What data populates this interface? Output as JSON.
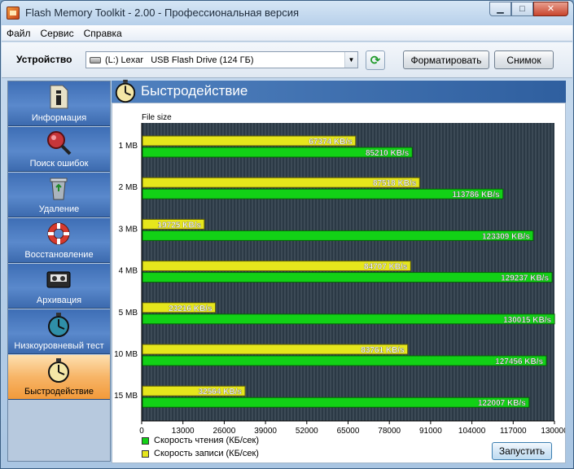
{
  "window": {
    "title": "Flash Memory Toolkit - 2.00 - Профессиональная версия"
  },
  "menu": [
    "Файл",
    "Сервис",
    "Справка"
  ],
  "toolbar": {
    "device_label": "Устройство",
    "device_value": "(L:) Lexar   USB Flash Drive (124 ГБ)",
    "format_label": "Форматировать",
    "snapshot_label": "Снимок"
  },
  "sidebar": {
    "items": [
      {
        "label": "Информация",
        "icon": "info-icon"
      },
      {
        "label": "Поиск ошибок",
        "icon": "magnifier-icon"
      },
      {
        "label": "Удаление",
        "icon": "recycle-bin-icon"
      },
      {
        "label": "Восстановление",
        "icon": "lifebuoy-icon"
      },
      {
        "label": "Архивация",
        "icon": "tape-icon"
      },
      {
        "label": "Низкоуровневый тест",
        "icon": "stopwatch-icon"
      },
      {
        "label": "Быстродействие",
        "icon": "stopwatch-icon",
        "active": true
      }
    ]
  },
  "main": {
    "title": "Быстродействие",
    "run_label": "Запустить"
  },
  "colors": {
    "read": "#12d116",
    "write": "#e6e61c",
    "plot_bg": "#2b3945",
    "active_tab": "#f5a24a"
  },
  "chart_data": {
    "type": "bar",
    "orientation": "horizontal",
    "ylabel": "File size",
    "categories": [
      "1 MB",
      "2 MB",
      "3 MB",
      "4 MB",
      "5 MB",
      "10 MB",
      "15 MB"
    ],
    "series": [
      {
        "name": "Скорость записи (КБ/сек)",
        "values": [
          67374,
          87518,
          19725,
          84707,
          23216,
          83761,
          32564
        ],
        "labels": [
          "67374 KB/s",
          "87518 KB/s",
          "19725 KB/s",
          "84707 KB/s",
          "23216 KB/s",
          "83761 KB/s",
          "32564 KB/s"
        ]
      },
      {
        "name": "Скорость чтения (КБ/сек)",
        "values": [
          85210,
          113786,
          123309,
          129237,
          130015,
          127456,
          122007
        ],
        "labels": [
          "85210 KB/s",
          "113786 KB/s",
          "123309 KB/s",
          "129237 KB/s",
          "130015 KB/s",
          "127456 KB/s",
          "122007 KB/s"
        ]
      }
    ],
    "xlim": [
      0,
      130000
    ],
    "xticks": [
      "0",
      "13000",
      "26000",
      "39000",
      "52000",
      "65000",
      "78000",
      "91000",
      "104000",
      "117000",
      "130000"
    ],
    "legend": [
      {
        "label": "Скорость чтения (КБ/сек)"
      },
      {
        "label": "Скорость записи (КБ/сек)"
      }
    ],
    "grid": true
  }
}
